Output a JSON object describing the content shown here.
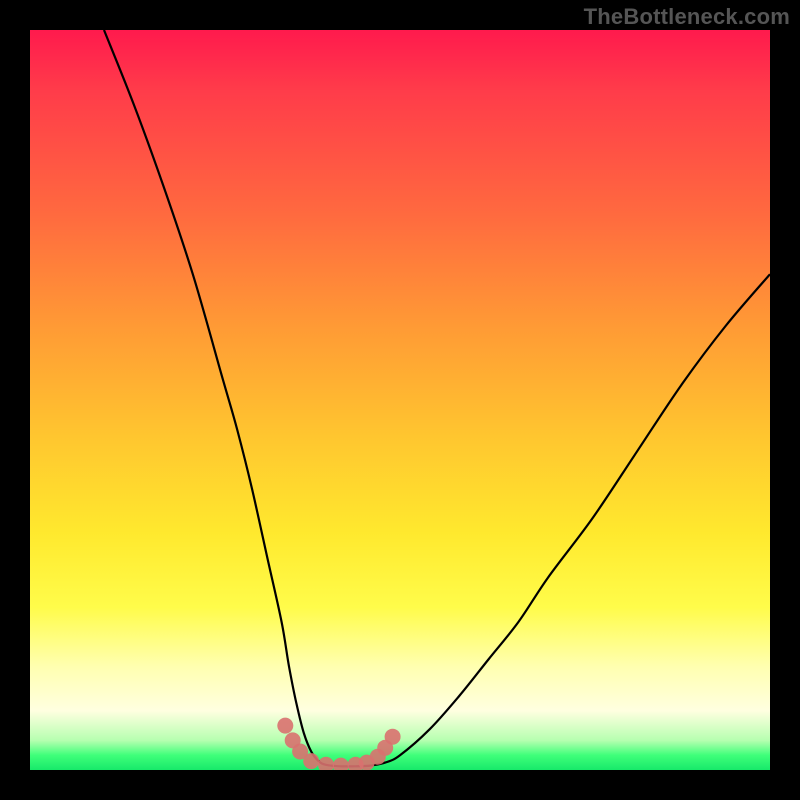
{
  "attribution": "TheBottleneck.com",
  "colors": {
    "frame": "#000000",
    "curve": "#000000",
    "marker": "#d9716f",
    "gradient_stops": [
      "#ff1a4d",
      "#ff6a3f",
      "#ffc62f",
      "#fffc4a",
      "#ffffe0",
      "#3fff7a",
      "#17e96a"
    ]
  },
  "chart_data": {
    "type": "line",
    "title": "",
    "xlabel": "",
    "ylabel": "",
    "xlim": [
      0,
      100
    ],
    "ylim": [
      0,
      100
    ],
    "note": "x is a normalized horizontal position (0 left, 100 right); y is normalized height above the bottom (0 = bottom baseline, 100 = top). Actual axis labels are not visible in the image so units are relative.",
    "series": [
      {
        "name": "bottleneck-curve",
        "x": [
          10,
          14,
          18,
          22,
          26,
          28,
          30,
          32,
          34,
          35,
          36,
          37,
          38,
          39,
          40,
          42,
          44,
          46,
          48,
          50,
          54,
          58,
          62,
          66,
          70,
          76,
          82,
          88,
          94,
          100
        ],
        "y": [
          100,
          90,
          79,
          67,
          53,
          46,
          38,
          29,
          20,
          14,
          9,
          5,
          2.5,
          1.2,
          0.7,
          0.5,
          0.5,
          0.6,
          1.0,
          2.0,
          5.5,
          10,
          15,
          20,
          26,
          34,
          43,
          52,
          60,
          67
        ]
      }
    ],
    "markers": {
      "name": "floor-dots",
      "note": "salmon-colored dots hugging the valley floor",
      "x": [
        34.5,
        35.5,
        36.5,
        38,
        40,
        42,
        44,
        45.5,
        47,
        48,
        49
      ],
      "y": [
        6,
        4,
        2.5,
        1.2,
        0.7,
        0.6,
        0.7,
        1.0,
        1.8,
        3.0,
        4.5
      ]
    }
  }
}
